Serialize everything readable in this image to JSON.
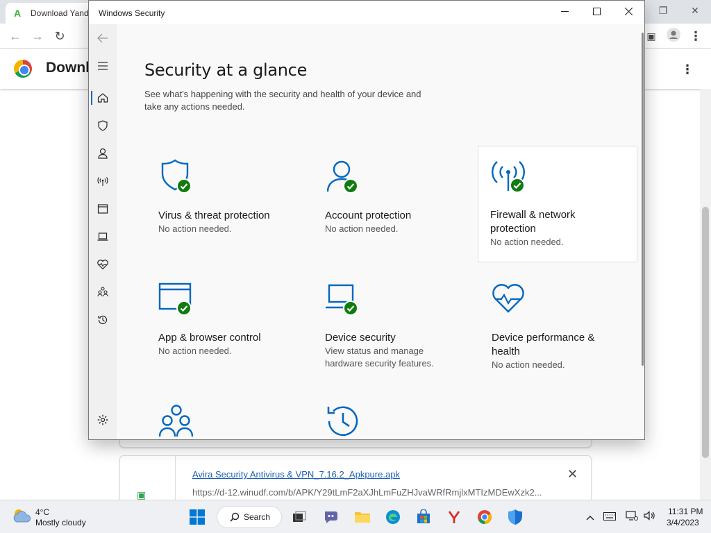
{
  "chrome": {
    "tab_title": "Download Yand",
    "page_heading": "Downl",
    "download": {
      "file_name": "Avira Security Antivirus & VPN_7.16.2_Apkpure.apk",
      "file_url": "https://d-12.winudf.com/b/APK/Y29tLmF2aXJhLmFuZHJvaWRfRmjlxMTIzMDEwXzk2..."
    }
  },
  "security_window": {
    "title": "Windows Security",
    "heading": "Security at a glance",
    "description": "See what's happening with the security and health of your device and take any actions needed.",
    "tiles": [
      {
        "title": "Virus & threat protection",
        "status": "No action needed.",
        "icon": "shield-icon"
      },
      {
        "title": "Account protection",
        "status": "No action needed.",
        "icon": "person-icon"
      },
      {
        "title": "Firewall & network protection",
        "status": "No action needed.",
        "icon": "antenna-icon"
      },
      {
        "title": "App & browser control",
        "status": "No action needed.",
        "icon": "app-window-icon"
      },
      {
        "title": "Device security",
        "status": "View status and manage hardware security features.",
        "icon": "laptop-icon"
      },
      {
        "title": "Device performance & health",
        "status": "No action needed.",
        "icon": "heart-pulse-icon"
      },
      {
        "title": "",
        "status": "",
        "icon": "family-icon"
      },
      {
        "title": "",
        "status": "",
        "icon": "history-icon"
      }
    ],
    "sidebar_items": [
      "home-icon",
      "shield-icon",
      "person-icon",
      "antenna-icon",
      "app-window-icon",
      "laptop-icon",
      "heart-pulse-icon",
      "family-icon",
      "history-icon",
      "settings-icon"
    ]
  },
  "taskbar": {
    "weather_temp": "4°C",
    "weather_desc": "Mostly cloudy",
    "search_label": "Search",
    "time": "11:31 PM",
    "date": "3/4/2023"
  },
  "colors": {
    "accent": "#0067c0",
    "check": "#107c10"
  }
}
